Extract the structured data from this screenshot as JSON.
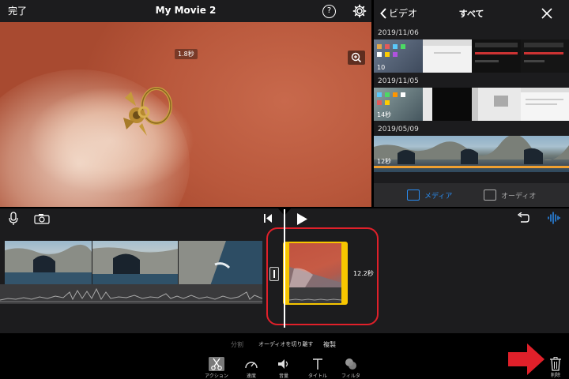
{
  "preview": {
    "done_label": "完了",
    "project_title": "My Movie 2",
    "help_label": "?",
    "clip_duration_badge": "1.8秒"
  },
  "browser": {
    "back_label": "ビデオ",
    "title": "すべて",
    "sections": [
      {
        "date": "2019/11/06",
        "thumb_label": "10"
      },
      {
        "date": "2019/11/05",
        "thumb_label": "14秒"
      },
      {
        "date": "2019/05/09",
        "thumb_label": "12秒"
      }
    ],
    "tabs": [
      {
        "label": "メディア",
        "active": true
      },
      {
        "label": "オーディオ",
        "active": false
      }
    ],
    "accent_color": "#2a8cf0"
  },
  "timeline": {
    "selected_clip_duration": "12.2秒",
    "selected_clip_color": "#f7c600",
    "highlight_color": "#e0202a"
  },
  "toolbar": {
    "sub_actions": {
      "split": "分割",
      "detach_audio": "オーディオを切り離す",
      "duplicate": "複製"
    },
    "tools": [
      {
        "label": "アクション",
        "icon": "scissors-icon"
      },
      {
        "label": "速度",
        "icon": "speedometer-icon"
      },
      {
        "label": "音量",
        "icon": "speaker-icon"
      },
      {
        "label": "タイトル",
        "icon": "title-t-icon"
      },
      {
        "label": "フィルタ",
        "icon": "filter-circles-icon"
      }
    ],
    "delete_label": "削除"
  }
}
